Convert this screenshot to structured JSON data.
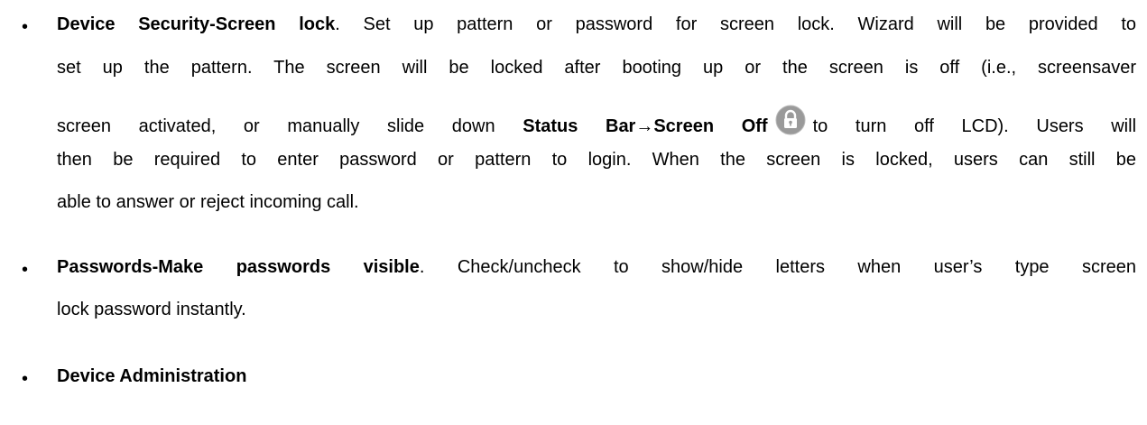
{
  "bullet_glyph": "•",
  "items": [
    {
      "title": "Device Security-Screen lock",
      "line1_rest": ". Set up pattern or password for screen lock. Wizard will be provided to",
      "line2": "set up the pattern. The screen will be locked after booting up or the screen is off (i.e., screensaver",
      "line3_pre": "screen activated, or manually slide down ",
      "line3_bold": "Status Bar→Screen Off",
      "line3_post": "to turn off LCD). Users will",
      "line4": "then be required to enter password or pattern to login. When the screen is locked, users can still be",
      "line5": "able to answer or reject incoming call."
    },
    {
      "title": "Passwords-Make passwords visible",
      "line1_rest": ". Check/uncheck to show/hide letters when user’s type screen",
      "line2": "lock password instantly."
    },
    {
      "title": "Device Administration"
    }
  ],
  "icons": {
    "screen_off": "lock-icon"
  }
}
